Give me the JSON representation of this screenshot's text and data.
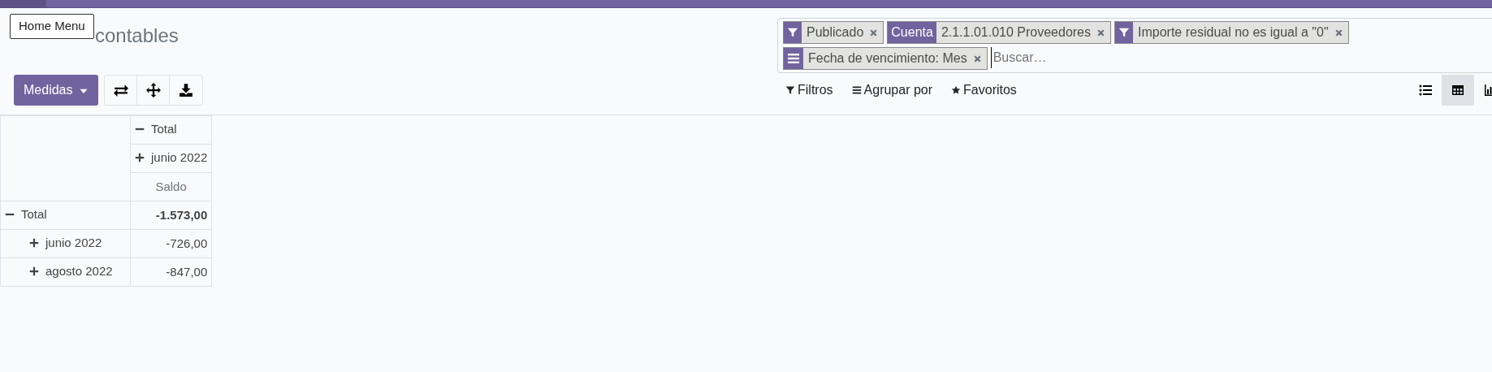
{
  "title": "contables",
  "tooltip": "Home Menu",
  "facets": [
    {
      "kind": "filter",
      "values": [
        "Publicado"
      ]
    },
    {
      "kind": "field",
      "label": "Cuenta",
      "values": [
        "2.1.1.01.010 Proveedores"
      ]
    },
    {
      "kind": "filter",
      "values": [
        "Importe residual no es igual a \"0\""
      ]
    },
    {
      "kind": "groupby",
      "values": [
        "Fecha de vencimiento: Mes"
      ]
    }
  ],
  "search": {
    "placeholder": "Buscar…"
  },
  "measures_button": "Medidas",
  "search_menus": [
    {
      "kind": "filter",
      "label": "Filtros"
    },
    {
      "kind": "groupby",
      "label": "Agrupar por"
    },
    {
      "kind": "favorite",
      "label": "Favoritos"
    }
  ],
  "views": [
    {
      "kind": "list",
      "selected": false
    },
    {
      "kind": "pivot",
      "selected": true
    },
    {
      "kind": "graph",
      "selected": false
    }
  ],
  "pivot": {
    "col_headers": [
      {
        "label": "Total",
        "expanded": true
      },
      {
        "label": "junio 2022",
        "expanded": false
      }
    ],
    "measure": "Saldo",
    "rows": [
      {
        "label": "Total",
        "expanded": true,
        "value": "-1.573,00",
        "children": [
          {
            "label": "junio 2022",
            "expanded": false,
            "value": "-726,00"
          },
          {
            "label": "agosto 2022",
            "expanded": false,
            "value": "-847,00"
          }
        ]
      }
    ]
  }
}
